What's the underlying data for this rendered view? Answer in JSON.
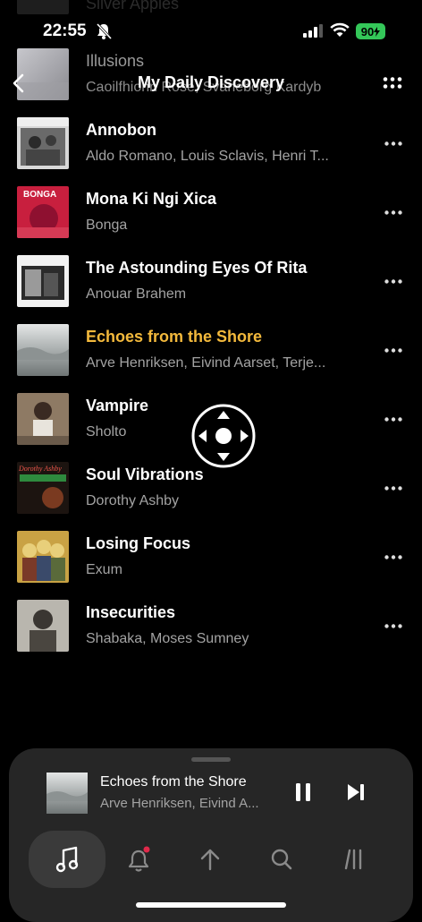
{
  "status_bar": {
    "time": "22:55",
    "battery": "90"
  },
  "header": {
    "title": "My Daily Discovery"
  },
  "ghost_track": {
    "title": "Silver Apples"
  },
  "tracks": [
    {
      "title": "Illusions",
      "artist": "Caoilfhionn Rose, Svaneborg Kardyb"
    },
    {
      "title": "Annobon",
      "artist": "Aldo Romano, Louis Sclavis, Henri T..."
    },
    {
      "title": "Mona Ki Ngi Xica",
      "artist": "Bonga"
    },
    {
      "title": "The Astounding Eyes Of Rita",
      "artist": "Anouar Brahem"
    },
    {
      "title": "Echoes from the Shore",
      "artist": "Arve Henriksen, Eivind Aarset, Terje..."
    },
    {
      "title": "Vampire",
      "artist": "Sholto"
    },
    {
      "title": "Soul Vibrations",
      "artist": "Dorothy Ashby"
    },
    {
      "title": "Losing Focus",
      "artist": "Exum"
    },
    {
      "title": "Insecurities",
      "artist": "Shabaka, Moses Sumney"
    }
  ],
  "album_art_text": {
    "bonga": "BONGA",
    "ashby": "Dorothy Ashby"
  },
  "now_playing": {
    "title": "Echoes from the Shore",
    "artist": "Arve Henriksen, Eivind A..."
  },
  "tabs": [
    "music-note-icon",
    "bell-icon",
    "upload-icon",
    "search-icon",
    "library-icon"
  ],
  "colors": {
    "accent": "#f3b93c",
    "background": "#000000",
    "player_bg": "#262626",
    "battery": "#34c759",
    "badge": "#e0294a"
  }
}
